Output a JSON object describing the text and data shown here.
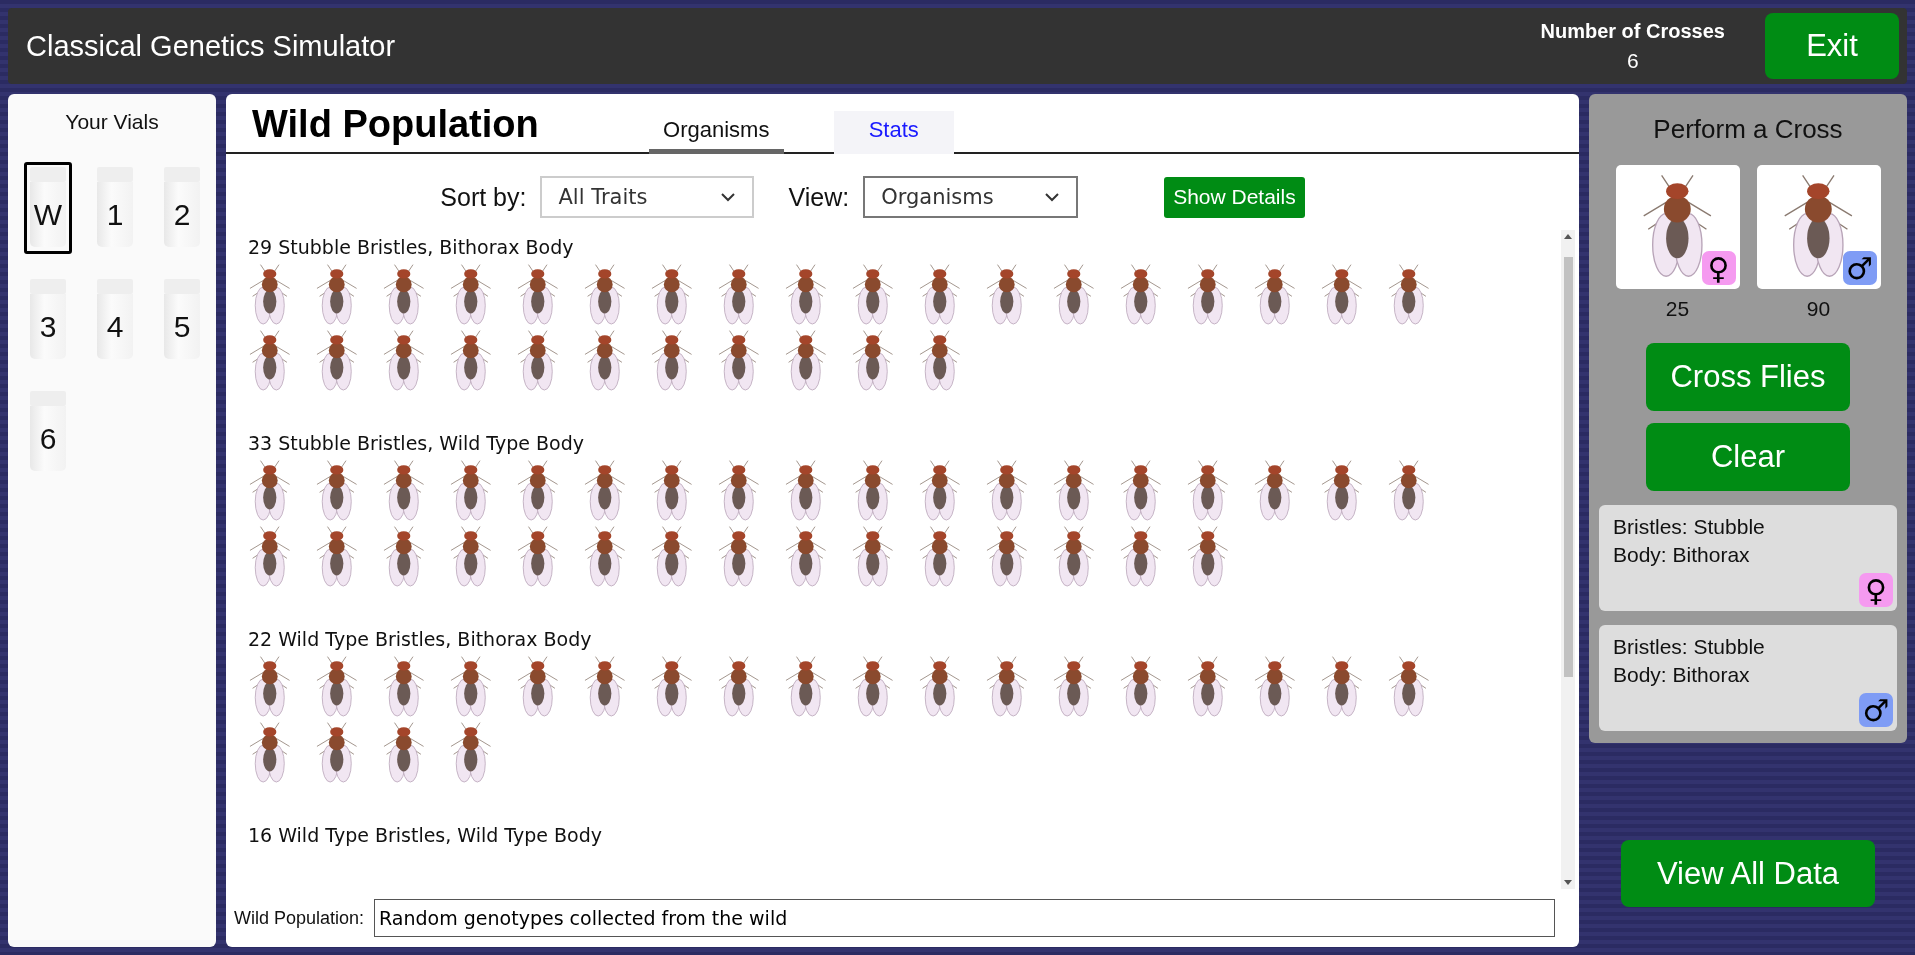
{
  "app_title": "Classical Genetics Simulator",
  "cross_counter": {
    "label": "Number of Crosses",
    "value": "6"
  },
  "exit_button": "Exit",
  "vials_panel": {
    "title": "Your Vials",
    "vials": [
      {
        "label": "W",
        "selected": true
      },
      {
        "label": "1",
        "selected": false
      },
      {
        "label": "2",
        "selected": false
      },
      {
        "label": "3",
        "selected": false
      },
      {
        "label": "4",
        "selected": false
      },
      {
        "label": "5",
        "selected": false
      },
      {
        "label": "6",
        "selected": false
      }
    ]
  },
  "main": {
    "title": "Wild Population",
    "tabs": [
      {
        "label": "Organisms",
        "selected": true
      },
      {
        "label": "Stats",
        "selected": false
      }
    ],
    "sort": {
      "label": "Sort by:",
      "value": "All Traits"
    },
    "view": {
      "label": "View:",
      "value": "Organisms"
    },
    "details_button": "Show Details",
    "groups": [
      {
        "label": "29 Stubble Bristles, Bithorax Body",
        "organisms": [
          {
            "kind": "fly"
          },
          {
            "kind": "fly"
          },
          {
            "kind": "fly"
          },
          {
            "kind": "fly"
          },
          {
            "kind": "fly"
          },
          {
            "kind": "fly"
          },
          {
            "kind": "fly"
          },
          {
            "kind": "fly"
          },
          {
            "kind": "fly"
          },
          {
            "kind": "fly"
          },
          {
            "kind": "fly"
          },
          {
            "kind": "fly"
          },
          {
            "kind": "fly"
          },
          {
            "kind": "fly"
          },
          {
            "kind": "fly"
          },
          {
            "kind": "fly"
          },
          {
            "kind": "fly"
          },
          {
            "kind": "fly"
          },
          {
            "kind": "fly"
          },
          {
            "kind": "fly"
          },
          {
            "kind": "fly"
          },
          {
            "kind": "fly"
          },
          {
            "kind": "fly"
          },
          {
            "kind": "fly"
          },
          {
            "kind": "fly"
          },
          {
            "kind": "fly"
          },
          {
            "kind": "fly"
          },
          {
            "kind": "fly"
          },
          {
            "kind": "fly"
          }
        ]
      },
      {
        "label": "33 Stubble Bristles, Wild Type Body",
        "organisms": [
          {
            "kind": "fly"
          },
          {
            "kind": "fly"
          },
          {
            "kind": "fly"
          },
          {
            "kind": "fly"
          },
          {
            "kind": "fly"
          },
          {
            "kind": "fly"
          },
          {
            "kind": "fly"
          },
          {
            "kind": "fly"
          },
          {
            "kind": "fly"
          },
          {
            "kind": "fly"
          },
          {
            "kind": "fly"
          },
          {
            "kind": "fly"
          },
          {
            "kind": "fly"
          },
          {
            "kind": "fly"
          },
          {
            "kind": "fly"
          },
          {
            "kind": "fly"
          },
          {
            "kind": "fly"
          },
          {
            "kind": "fly"
          },
          {
            "kind": "fly"
          },
          {
            "kind": "fly"
          },
          {
            "kind": "fly"
          },
          {
            "kind": "fly"
          },
          {
            "kind": "fly"
          },
          {
            "kind": "fly"
          },
          {
            "kind": "fly"
          },
          {
            "kind": "fly"
          },
          {
            "kind": "fly"
          },
          {
            "kind": "fly"
          },
          {
            "kind": "fly"
          },
          {
            "kind": "fly"
          },
          {
            "kind": "fly"
          },
          {
            "kind": "fly"
          },
          {
            "kind": "fly"
          }
        ]
      },
      {
        "label": "22 Wild Type Bristles, Bithorax Body",
        "organisms": [
          {
            "kind": "fly"
          },
          {
            "kind": "fly"
          },
          {
            "kind": "fly"
          },
          {
            "kind": "fly"
          },
          {
            "kind": "fly"
          },
          {
            "kind": "fly"
          },
          {
            "kind": "fly"
          },
          {
            "kind": "fly"
          },
          {
            "kind": "fly"
          },
          {
            "kind": "fly"
          },
          {
            "kind": "fly"
          },
          {
            "kind": "fly"
          },
          {
            "kind": "fly"
          },
          {
            "kind": "fly"
          },
          {
            "kind": "fly"
          },
          {
            "kind": "fly"
          },
          {
            "kind": "fly"
          },
          {
            "kind": "fly"
          },
          {
            "kind": "fly"
          },
          {
            "kind": "fly"
          },
          {
            "kind": "fly"
          },
          {
            "kind": "fly"
          }
        ]
      },
      {
        "label": "16 Wild Type Bristles, Wild Type Body"
      }
    ],
    "description": {
      "label": "Wild Population:",
      "value": "Random genotypes collected from the wild"
    }
  },
  "cross_panel": {
    "title": "Perform a Cross",
    "parents": [
      {
        "sex": "♀",
        "color": "#f59af0",
        "count": "25"
      },
      {
        "sex": "♂",
        "color": "#7f9cf5",
        "count": "90"
      }
    ],
    "buttons": [
      "Cross Flies",
      "Clear"
    ],
    "traits": [
      {
        "lines": [
          "Bristles: Stubble",
          "Body: Bithorax"
        ],
        "sex": "♀",
        "color": "#f59af0"
      },
      {
        "lines": [
          "Bristles: Stubble",
          "Body: Bithorax"
        ],
        "sex": "♂",
        "color": "#7f9cf5"
      }
    ]
  },
  "view_all_button": "View All Data"
}
